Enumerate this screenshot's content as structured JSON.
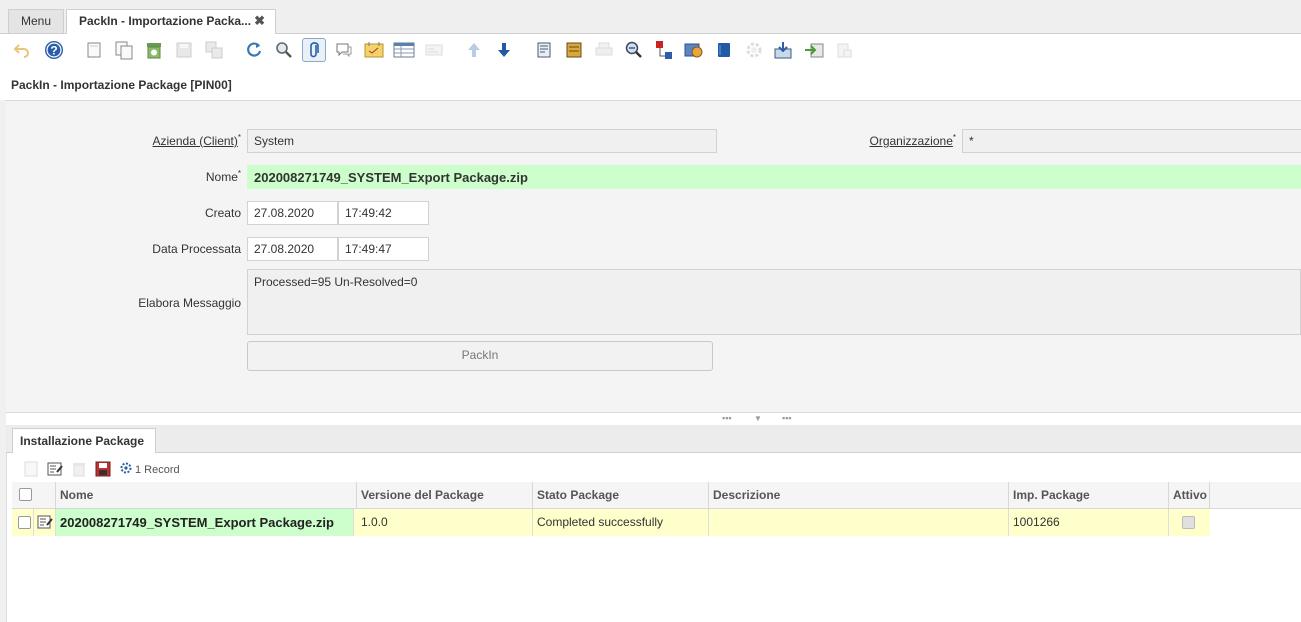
{
  "tabs": {
    "menu_label": "Menu",
    "active_label": "PackIn - Importazione Packa...",
    "close_symbol": "✖"
  },
  "toolbar": {
    "icons": [
      "undo-icon",
      "help-icon",
      "new-record-icon",
      "copy-record-icon",
      "delete-icon",
      "save-icon",
      "save-new-icon",
      "refresh-icon",
      "find-icon",
      "attachment-icon",
      "chat-icon",
      "note-icon",
      "grid-toggle-icon",
      "parent-record-icon",
      "previous-record-icon",
      "next-record-icon",
      "report-icon",
      "archive-icon",
      "print-icon",
      "zoom-across-icon",
      "request-icon",
      "product-info-icon",
      "workflow-icon",
      "process-icon",
      "export-icon",
      "import-icon",
      "close-window-icon"
    ]
  },
  "document": {
    "title": "PackIn - Importazione Package [PIN00]"
  },
  "form": {
    "client_label": "Azienda (Client)",
    "client_value": "System",
    "org_label": "Organizzazione",
    "org_value": "*",
    "name_label": "Nome",
    "name_value": "202008271749_SYSTEM_Export Package.zip",
    "created_label": "Creato",
    "created_date": "27.08.2020",
    "created_time": "17:49:42",
    "processed_label": "Data Processata",
    "processed_date": "27.08.2020",
    "processed_time": "17:49:47",
    "message_label": "Elabora Messaggio",
    "message_value": "Processed=95 Un-Resolved=0",
    "packin_button": "PackIn",
    "required_mark": "*"
  },
  "detail": {
    "tab_label": "Installazione Package",
    "record_count": "1 Record",
    "columns": [
      "Nome",
      "Versione del Package",
      "Stato Package",
      "Descrizione",
      "Imp. Package",
      "Attivo"
    ],
    "rows": [
      {
        "name": "202008271749_SYSTEM_Export Package.zip",
        "version": "1.0.0",
        "status": "Completed successfully",
        "description": "",
        "imp_package": "1001266",
        "active": false
      }
    ]
  },
  "colors": {
    "mandatory_field": "#ccffcc",
    "selected_row": "#ffffcc",
    "accent_blue": "#2a5fa8"
  }
}
